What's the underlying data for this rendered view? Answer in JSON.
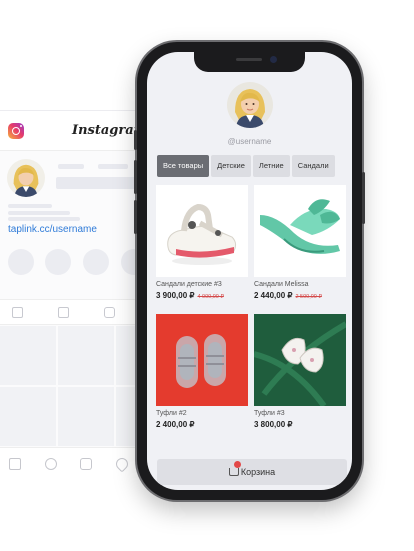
{
  "instagram": {
    "brand": "Instagram",
    "link": "taplink.cc/username"
  },
  "profile": {
    "username": "@username"
  },
  "categories": [
    {
      "label": "Все товары",
      "active": true
    },
    {
      "label": "Детские",
      "active": false
    },
    {
      "label": "Летние",
      "active": false
    },
    {
      "label": "Сандали",
      "active": false
    }
  ],
  "products": [
    {
      "name": "Сандали детские #3",
      "price": "3 900,00 ₽",
      "old_price": "4 000,00 ₽"
    },
    {
      "name": "Сандали Melissa",
      "price": "2 440,00 ₽",
      "old_price": "2 500,00 ₽"
    },
    {
      "name": "Туфли #2",
      "price": "2 400,00 ₽",
      "old_price": ""
    },
    {
      "name": "Туфли #3",
      "price": "3 800,00 ₽",
      "old_price": ""
    }
  ],
  "cart": {
    "label": "Корзина",
    "badge_color": "#e34848"
  },
  "colors": {
    "active_tab": "#6b6d73",
    "link": "#2f7bd8",
    "old_price": "#d44a4a"
  }
}
